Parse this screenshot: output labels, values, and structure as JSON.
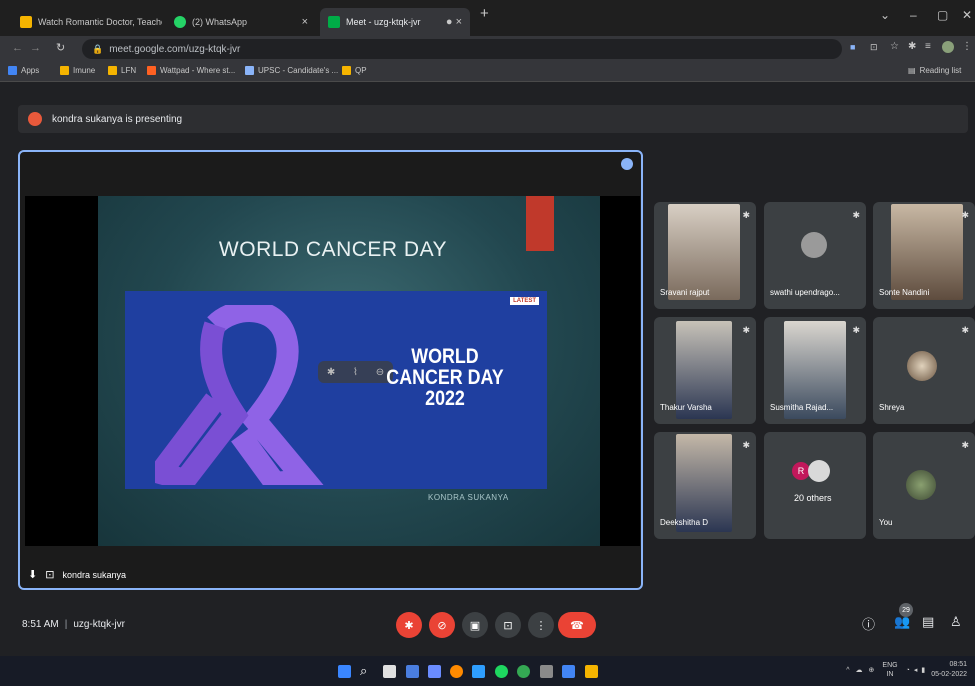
{
  "browser": {
    "tabs": [
      {
        "label": "Watch Romantic Doctor, Teacher",
        "fav_color": "#f5b400"
      },
      {
        "label": "(2) WhatsApp",
        "fav_color": "#25d366"
      },
      {
        "label": "Meet - uzg-ktqk-jvr",
        "fav_color": "#00ac47"
      }
    ],
    "url": "meet.google.com/uzg-ktqk-jvr",
    "bookmarks": [
      {
        "label": "Apps",
        "color": "#4285f4"
      },
      {
        "label": "Imune",
        "color": "#f5b400"
      },
      {
        "label": "LFN",
        "color": "#f5b400"
      },
      {
        "label": "Wattpad - Where st...",
        "color": "#ff6122"
      },
      {
        "label": "UPSC - Candidate's ...",
        "color": "#8ab4f8"
      },
      {
        "label": "QP",
        "color": "#f5b400"
      }
    ],
    "reading_list": "Reading list"
  },
  "meet": {
    "presenting_text": "kondra sukanya is presenting",
    "slide": {
      "title": "WORLD CANCER DAY",
      "tag": "LATEST",
      "banner_line1": "WORLD",
      "banner_line2": "CANCER DAY",
      "banner_line3": "2022",
      "author": "KONDRA SUKANYA"
    },
    "main_tile_name": "kondra sukanya",
    "participants": [
      {
        "name": "Sravani rajput"
      },
      {
        "name": "swathi upendrago..."
      },
      {
        "name": "Sonte Nandini"
      },
      {
        "name": "Thakur Varsha"
      },
      {
        "name": "Susmitha Rajad..."
      },
      {
        "name": "Shreya"
      },
      {
        "name": "Deekshitha D"
      },
      {
        "name": "20 others"
      },
      {
        "name": "You"
      }
    ],
    "others_avatar_letter": "R",
    "time": "8:51 AM",
    "meeting_code": "uzg-ktqk-jvr",
    "people_count": "29"
  },
  "taskbar": {
    "lang_top": "ENG",
    "lang_bottom": "IN",
    "clock_time": "08:51",
    "clock_date": "05-02-2022"
  }
}
